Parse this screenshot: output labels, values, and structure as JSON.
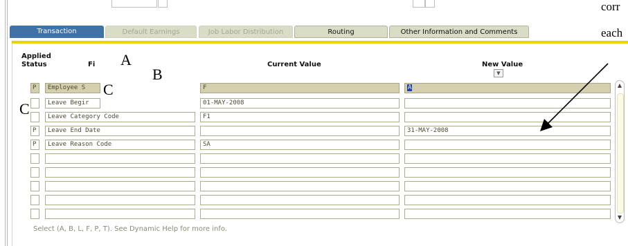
{
  "right_text": {
    "line1": "corr",
    "line2": "each"
  },
  "tabs": [
    {
      "label": "Transaction"
    },
    {
      "label": "Default Earnings"
    },
    {
      "label": "Job Labor Distribution"
    },
    {
      "label": "Routing"
    },
    {
      "label": "Other Information and Comments"
    }
  ],
  "headers": {
    "applied": "Applied",
    "status": "Status",
    "field": "Fi",
    "current_value": "Current Value",
    "new_value": "New Value"
  },
  "overlay_letters": {
    "a": "A",
    "b": "B",
    "c1": "C",
    "c2": "C"
  },
  "rows": [
    {
      "status": "P",
      "field": "Employee S",
      "current": "F",
      "new": "A"
    },
    {
      "status": "",
      "field": "Leave Begir",
      "current": "01-MAY-2008",
      "new": ""
    },
    {
      "status": "",
      "field": "Leave Category Code",
      "current": "F1",
      "new": ""
    },
    {
      "status": "P",
      "field": "Leave End Date",
      "current": "",
      "new": "31-MAY-2008"
    },
    {
      "status": "P",
      "field": "Leave Reason Code",
      "current": "SA",
      "new": ""
    },
    {
      "status": "",
      "field": "",
      "current": "",
      "new": ""
    },
    {
      "status": "",
      "field": "",
      "current": "",
      "new": ""
    },
    {
      "status": "",
      "field": "",
      "current": "",
      "new": ""
    },
    {
      "status": "",
      "field": "",
      "current": "",
      "new": ""
    },
    {
      "status": "",
      "field": "",
      "current": "",
      "new": ""
    }
  ],
  "footer": "Select (A, B, L, F, P, T).  See Dynamic Help for more info.",
  "colors": {
    "tab_active": "#3f72a6",
    "tab_bg": "#d9ddc6",
    "accent_bar": "#e4d800",
    "highlight_row": "#d4cfae",
    "selection": "#1f3fb0"
  }
}
